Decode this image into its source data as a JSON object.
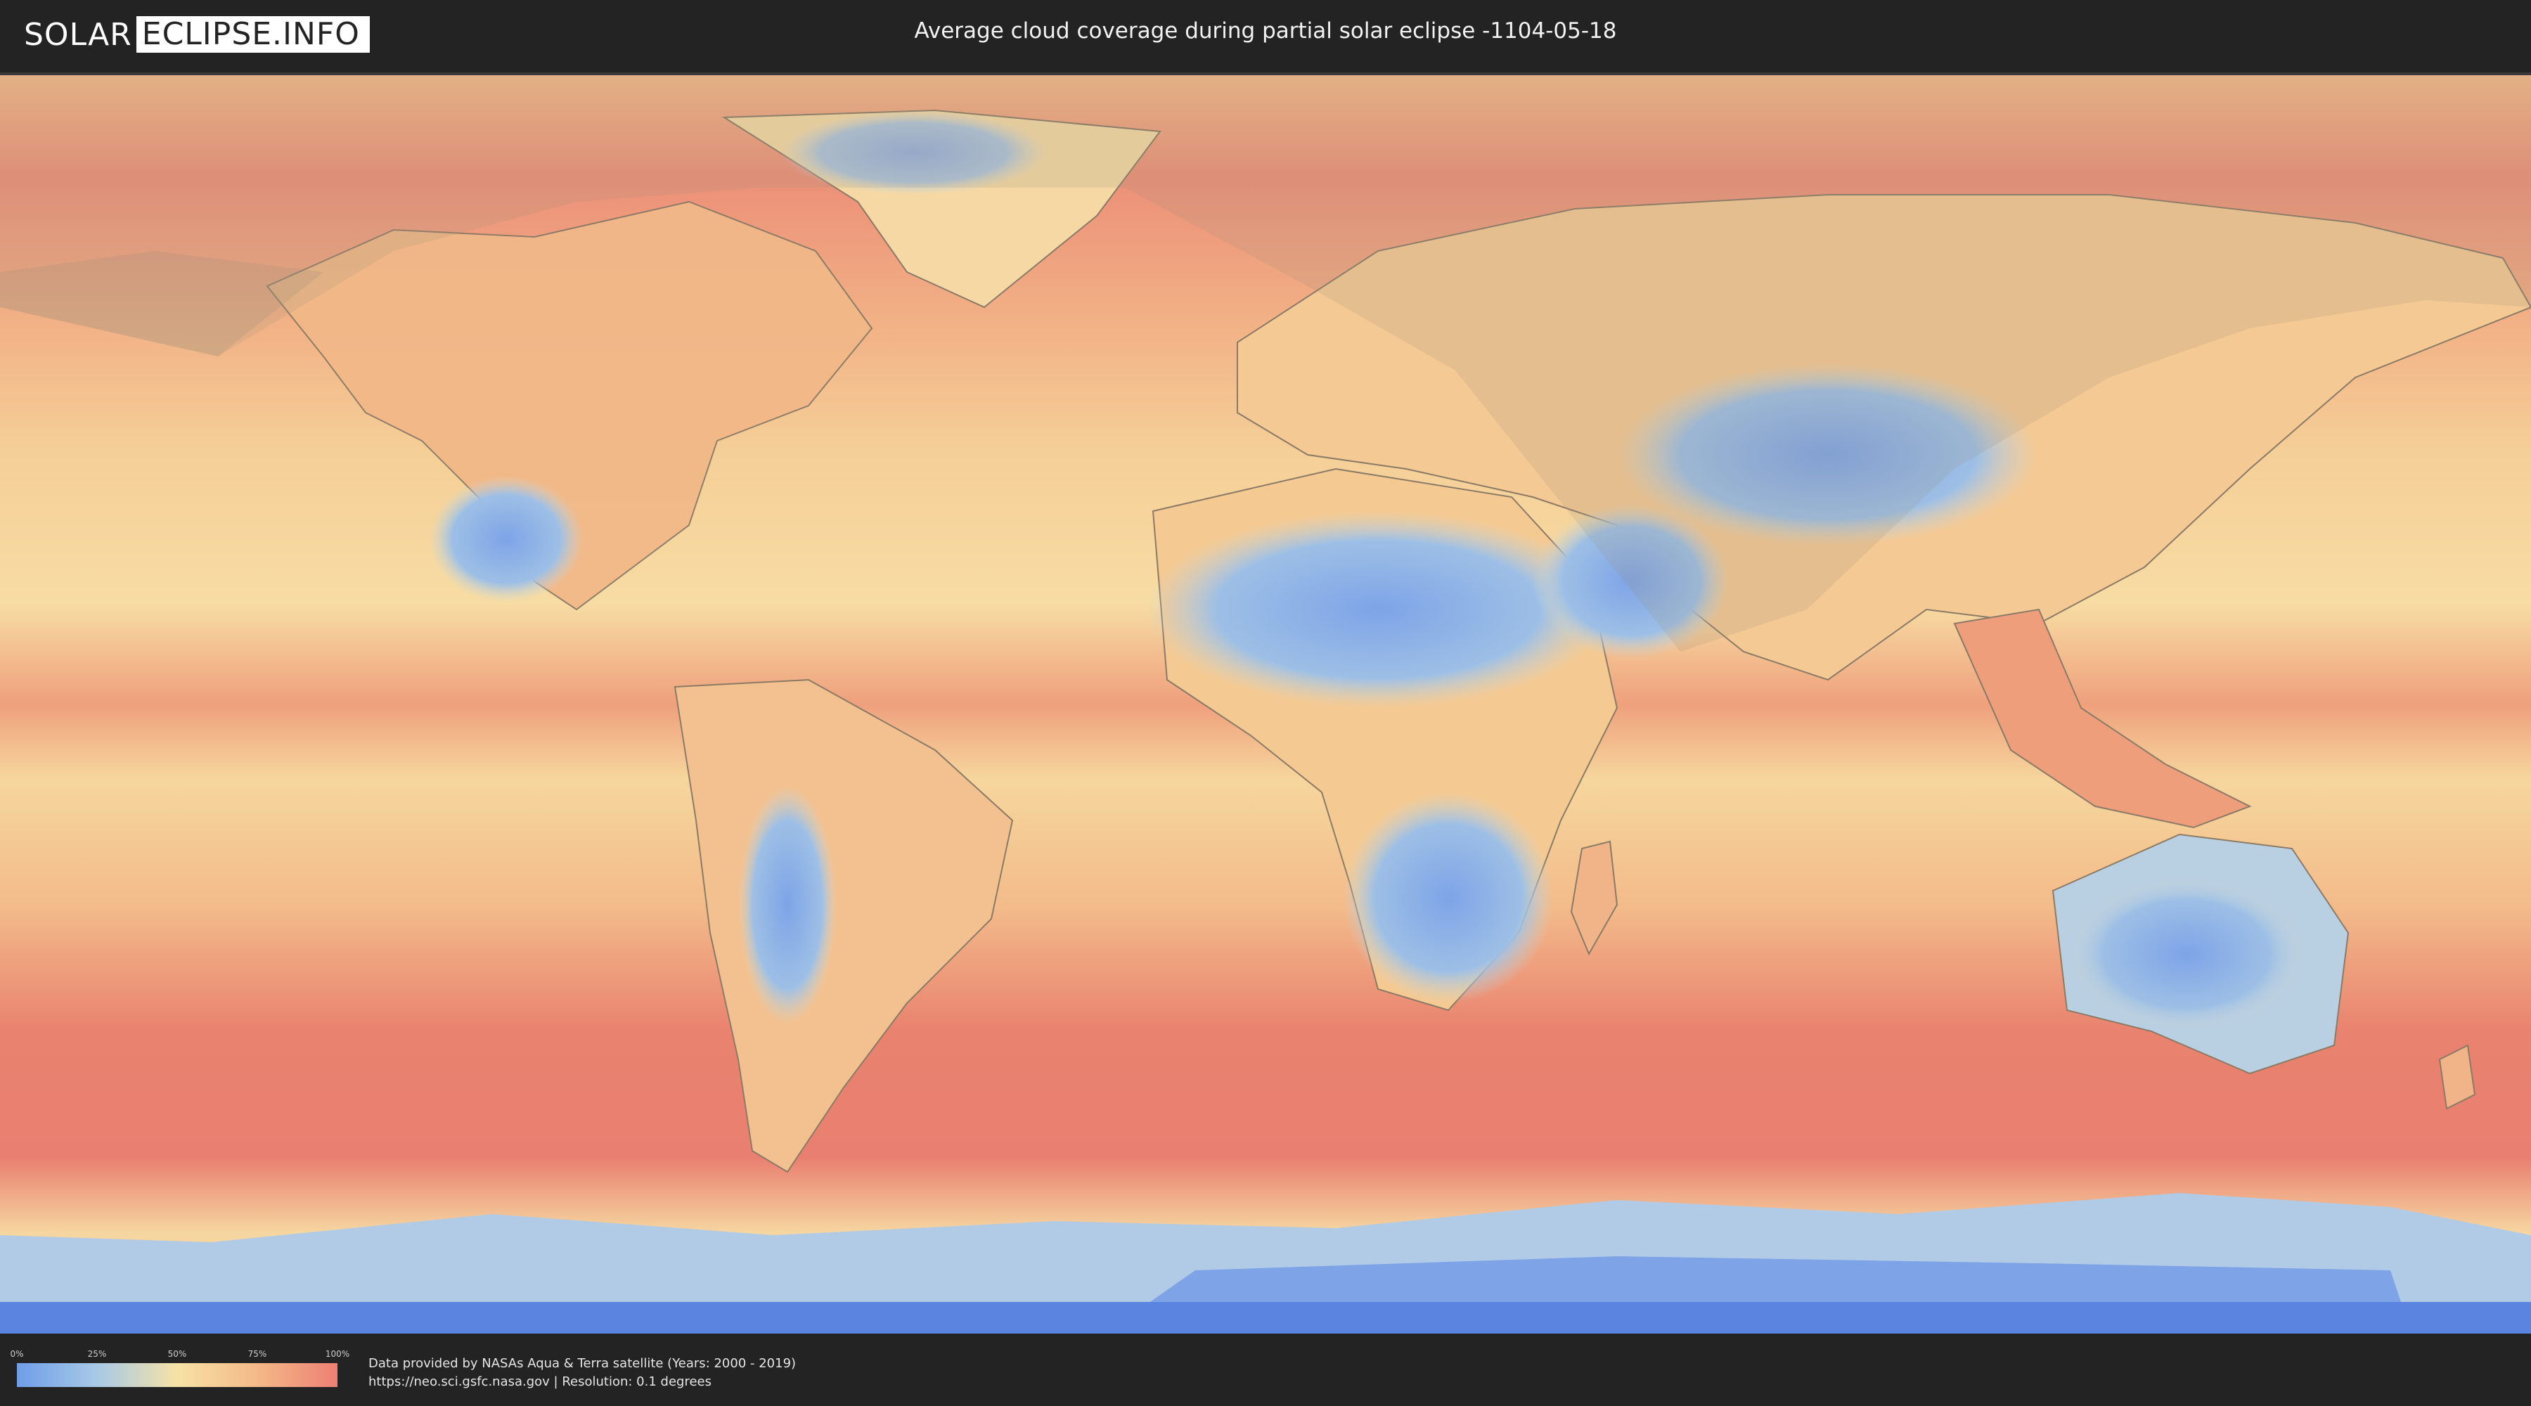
{
  "header": {
    "logo_left": "SOLAR",
    "logo_right": "ECLIPSE.INFO",
    "title": "Average cloud coverage during partial solar eclipse -1104-05-18"
  },
  "legend": {
    "ticks": [
      "0%",
      "25%",
      "50%",
      "75%",
      "100%"
    ],
    "colors": [
      "#6f9ee8",
      "#a8c9e6",
      "#f6e2a6",
      "#f4b987",
      "#ee7f74"
    ]
  },
  "footer": {
    "credit_line1": "Data provided by NASAs Aqua & Terra satellite (Years: 2000 - 2019)",
    "credit_line2": "https://neo.sci.gsfc.nasa.gov | Resolution: 0.1 degrees"
  },
  "map": {
    "projection": "equirectangular",
    "overlay": "partial eclipse visibility zone",
    "palette": {
      "clear": "#7fa7e6",
      "low": "#b4cfe6",
      "mid": "#f6dca0",
      "high": "#f3b888",
      "full": "#e98a72",
      "antarctic": "#5b84e0"
    }
  }
}
